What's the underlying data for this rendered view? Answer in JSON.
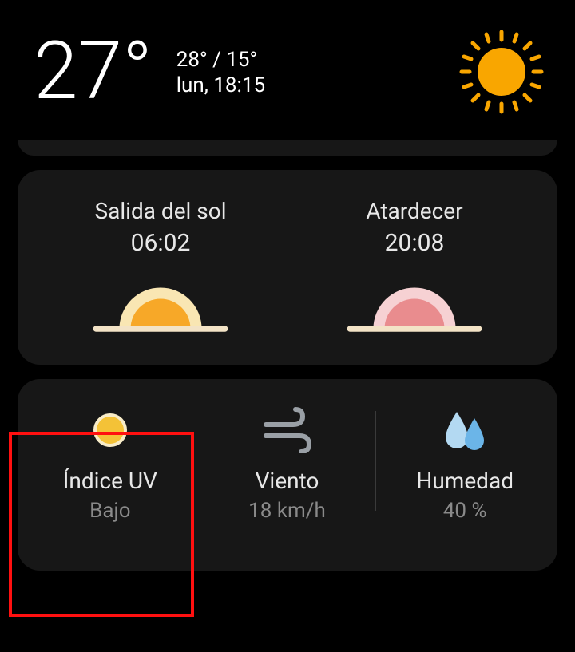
{
  "header": {
    "current_temp": "27°",
    "high_low": "28° / 15°",
    "datetime": "lun, 18:15"
  },
  "sun": {
    "sunrise_label": "Salida del sol",
    "sunrise_time": "06:02",
    "sunset_label": "Atardecer",
    "sunset_time": "20:08"
  },
  "metrics": {
    "uv": {
      "label": "Índice UV",
      "value": "Bajo"
    },
    "wind": {
      "label": "Viento",
      "value": "18 km/h"
    },
    "humidity": {
      "label": "Humedad",
      "value": "40 %"
    }
  },
  "colors": {
    "sun": "#ffa500",
    "sunrise_fill": "#f7a828",
    "sunrise_glow": "#f9e6b3",
    "sunset_fill": "#e98c8e",
    "sunset_glow": "#f6d1d3",
    "horizon": "#f3e3c6",
    "uv_dot": "#f4c237",
    "uv_ring": "#f8ecc8",
    "wind": "#9aa0a6",
    "humidity_drop1": "#b3d9f2",
    "humidity_drop2": "#6bb5e8"
  }
}
